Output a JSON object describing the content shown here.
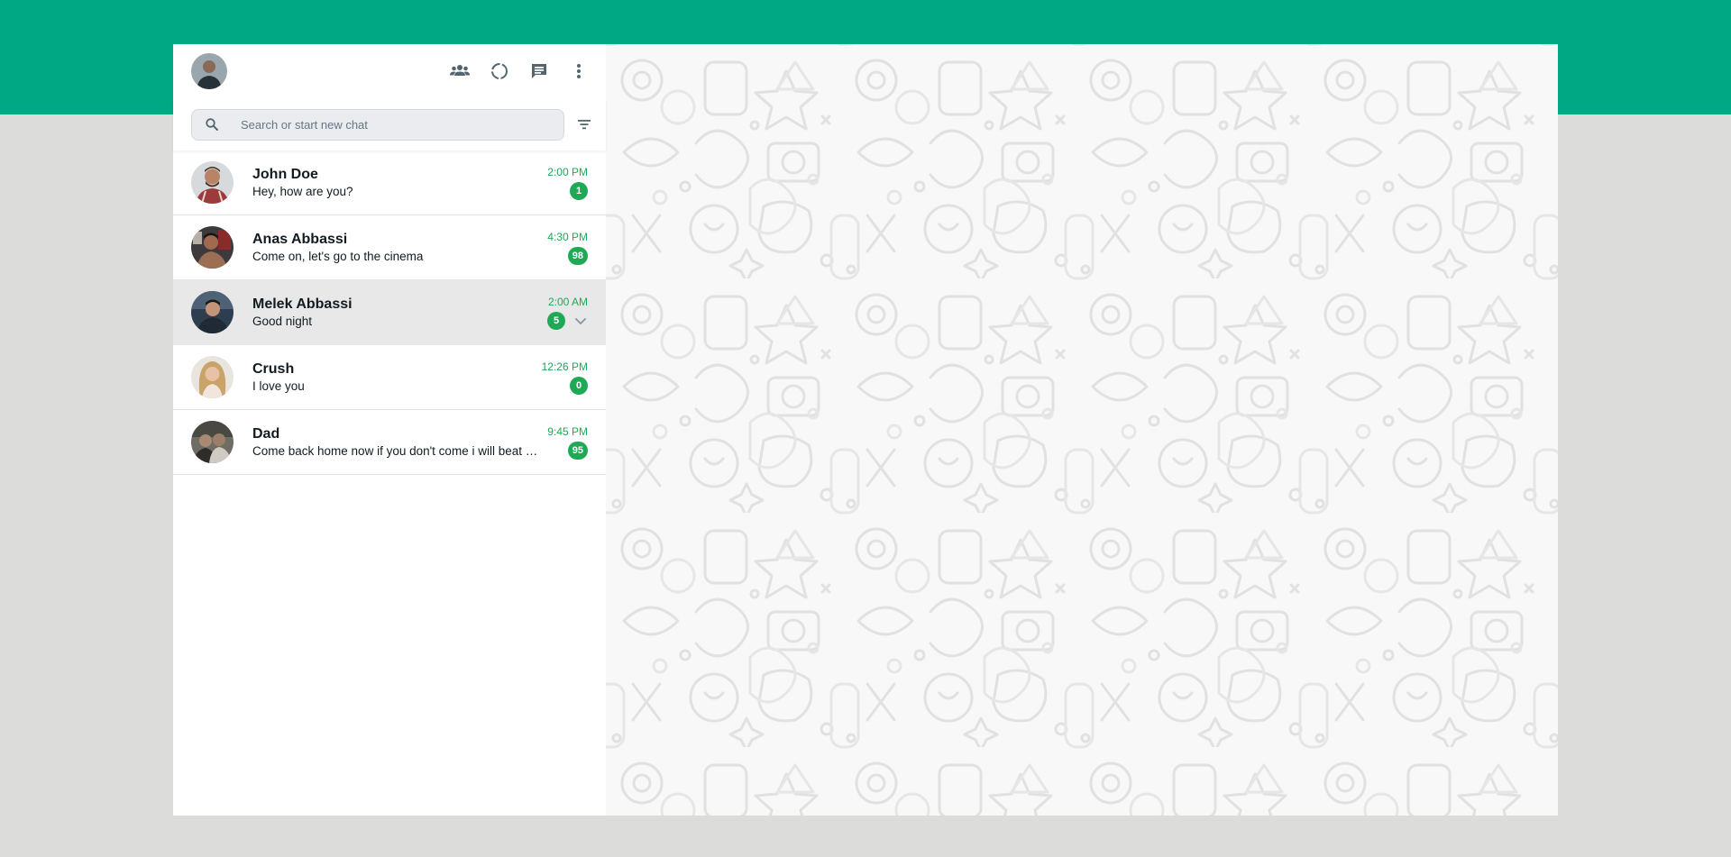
{
  "header": {
    "icons": [
      "community-icon",
      "status-icon",
      "new-chat-icon",
      "menu-icon"
    ]
  },
  "search": {
    "placeholder": "Search or start new chat"
  },
  "chats": [
    {
      "name": "John Doe",
      "message": "Hey, how are you?",
      "time": "2:00 PM",
      "unread": "1",
      "active": false
    },
    {
      "name": "Anas Abbassi",
      "message": "Come on, let's go to the cinema",
      "time": "4:30 PM",
      "unread": "98",
      "active": false
    },
    {
      "name": "Melek Abbassi",
      "message": "Good night",
      "time": "2:00 AM",
      "unread": "5",
      "active": true
    },
    {
      "name": "Crush",
      "message": "I love you",
      "time": "12:26 PM",
      "unread": "0",
      "active": false
    },
    {
      "name": "Dad",
      "message": "Come back home now if you don't come i will beat you",
      "time": "9:45 PM",
      "unread": "95",
      "active": false
    }
  ],
  "colors": {
    "accent": "#00a884",
    "badge": "#1fa855",
    "background": "#dcdcdb",
    "active_row": "#e8e8e8"
  }
}
